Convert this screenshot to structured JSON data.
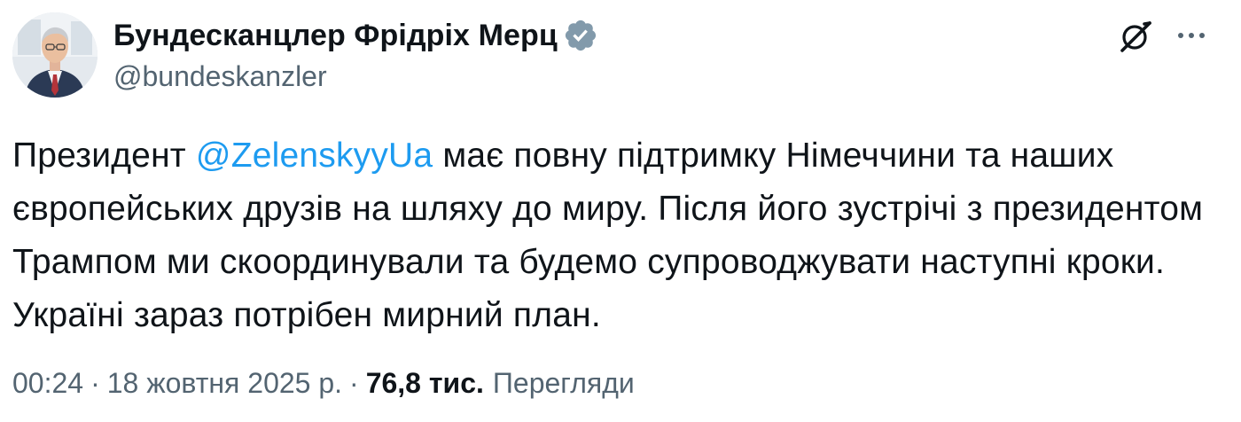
{
  "author": {
    "name": "Бундесканцлер Фрідріх Мерц",
    "handle": "@bundeskanzler",
    "verified_color": "#829aab"
  },
  "tweet": {
    "text_before": "Президент ",
    "mention": "@ZelenskyyUa",
    "text_after": " має повну підтримку Німеччини та наших європейських друзів на шляху до миру. Після його зустрічі з президентом Трампом ми скоординували та будемо супроводжувати наступні кроки. Україні зараз потрібен мирний план."
  },
  "meta": {
    "time": "00:24",
    "separator": "·",
    "date": "18 жовтня 2025 р.",
    "views_count": "76,8 тис.",
    "views_label": "Перегляди"
  },
  "icons": {
    "avatar": "avatar-photo",
    "verified": "verified-badge-icon",
    "grok": "grok-icon",
    "more": "more-options-icon"
  },
  "colors": {
    "text": "#0f1419",
    "secondary": "#536471",
    "link": "#1d9bf0"
  }
}
